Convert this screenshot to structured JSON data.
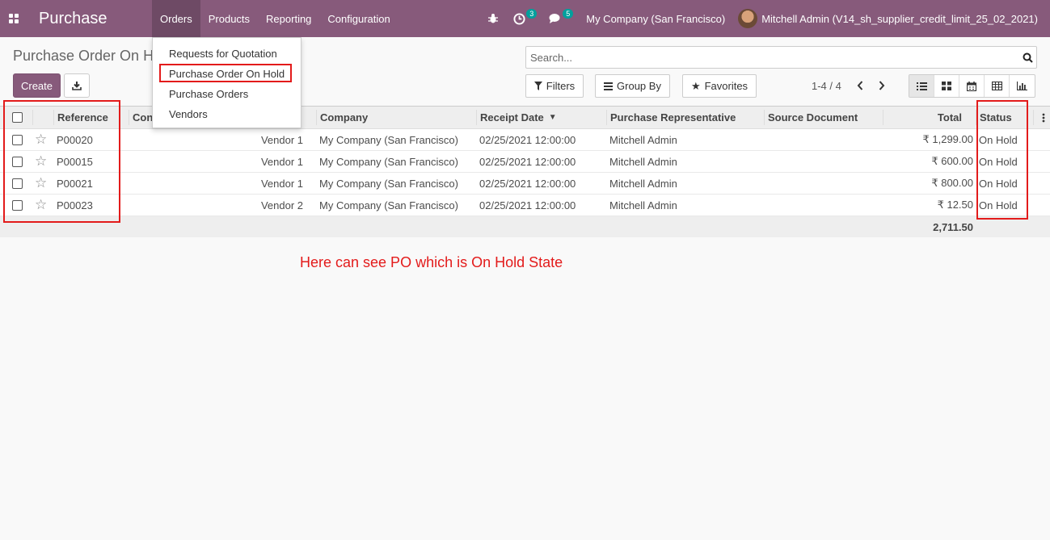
{
  "navbar": {
    "app_name": "Purchase",
    "menu": [
      "Orders",
      "Products",
      "Reporting",
      "Configuration"
    ],
    "activity_count": "3",
    "messages_count": "5",
    "company": "My Company (San Francisco)",
    "user": "Mitchell Admin (V14_sh_supplier_credit_limit_25_02_2021)"
  },
  "orders_menu": {
    "items": [
      "Requests for Quotation",
      "Purchase Order On Hold",
      "Purchase Orders",
      "Vendors"
    ]
  },
  "control_panel": {
    "breadcrumb": "Purchase Order On H",
    "create_label": "Create",
    "search_placeholder": "Search...",
    "filters_label": "Filters",
    "groupby_label": "Group By",
    "favorites_label": "Favorites",
    "pager": "1-4 / 4"
  },
  "table": {
    "headers": {
      "reference": "Reference",
      "confirmation": "Con",
      "company": "Company",
      "receipt_date": "Receipt Date",
      "representative": "Purchase Representative",
      "source": "Source Document",
      "total": "Total",
      "status": "Status"
    },
    "rows": [
      {
        "reference": "P00020",
        "vendor": "Vendor 1",
        "company": "My Company (San Francisco)",
        "date": "02/25/2021 12:00:00",
        "rep": "Mitchell Admin",
        "source": "",
        "total": "₹ 1,299.00",
        "status": "On Hold"
      },
      {
        "reference": "P00015",
        "vendor": "Vendor 1",
        "company": "My Company (San Francisco)",
        "date": "02/25/2021 12:00:00",
        "rep": "Mitchell Admin",
        "source": "",
        "total": "₹ 600.00",
        "status": "On Hold"
      },
      {
        "reference": "P00021",
        "vendor": "Vendor 1",
        "company": "My Company (San Francisco)",
        "date": "02/25/2021 12:00:00",
        "rep": "Mitchell Admin",
        "source": "",
        "total": "₹ 800.00",
        "status": "On Hold"
      },
      {
        "reference": "P00023",
        "vendor": "Vendor 2",
        "company": "My Company (San Francisco)",
        "date": "02/25/2021 12:00:00",
        "rep": "Mitchell Admin",
        "source": "",
        "total": "₹ 12.50",
        "status": "On Hold"
      }
    ],
    "footer_total": "2,711.50"
  },
  "annotation": {
    "text": "Here can see PO which is On Hold State",
    "color": "#e31b1b"
  },
  "colors": {
    "brand": "#875a7b",
    "badge": "#00a09d"
  }
}
